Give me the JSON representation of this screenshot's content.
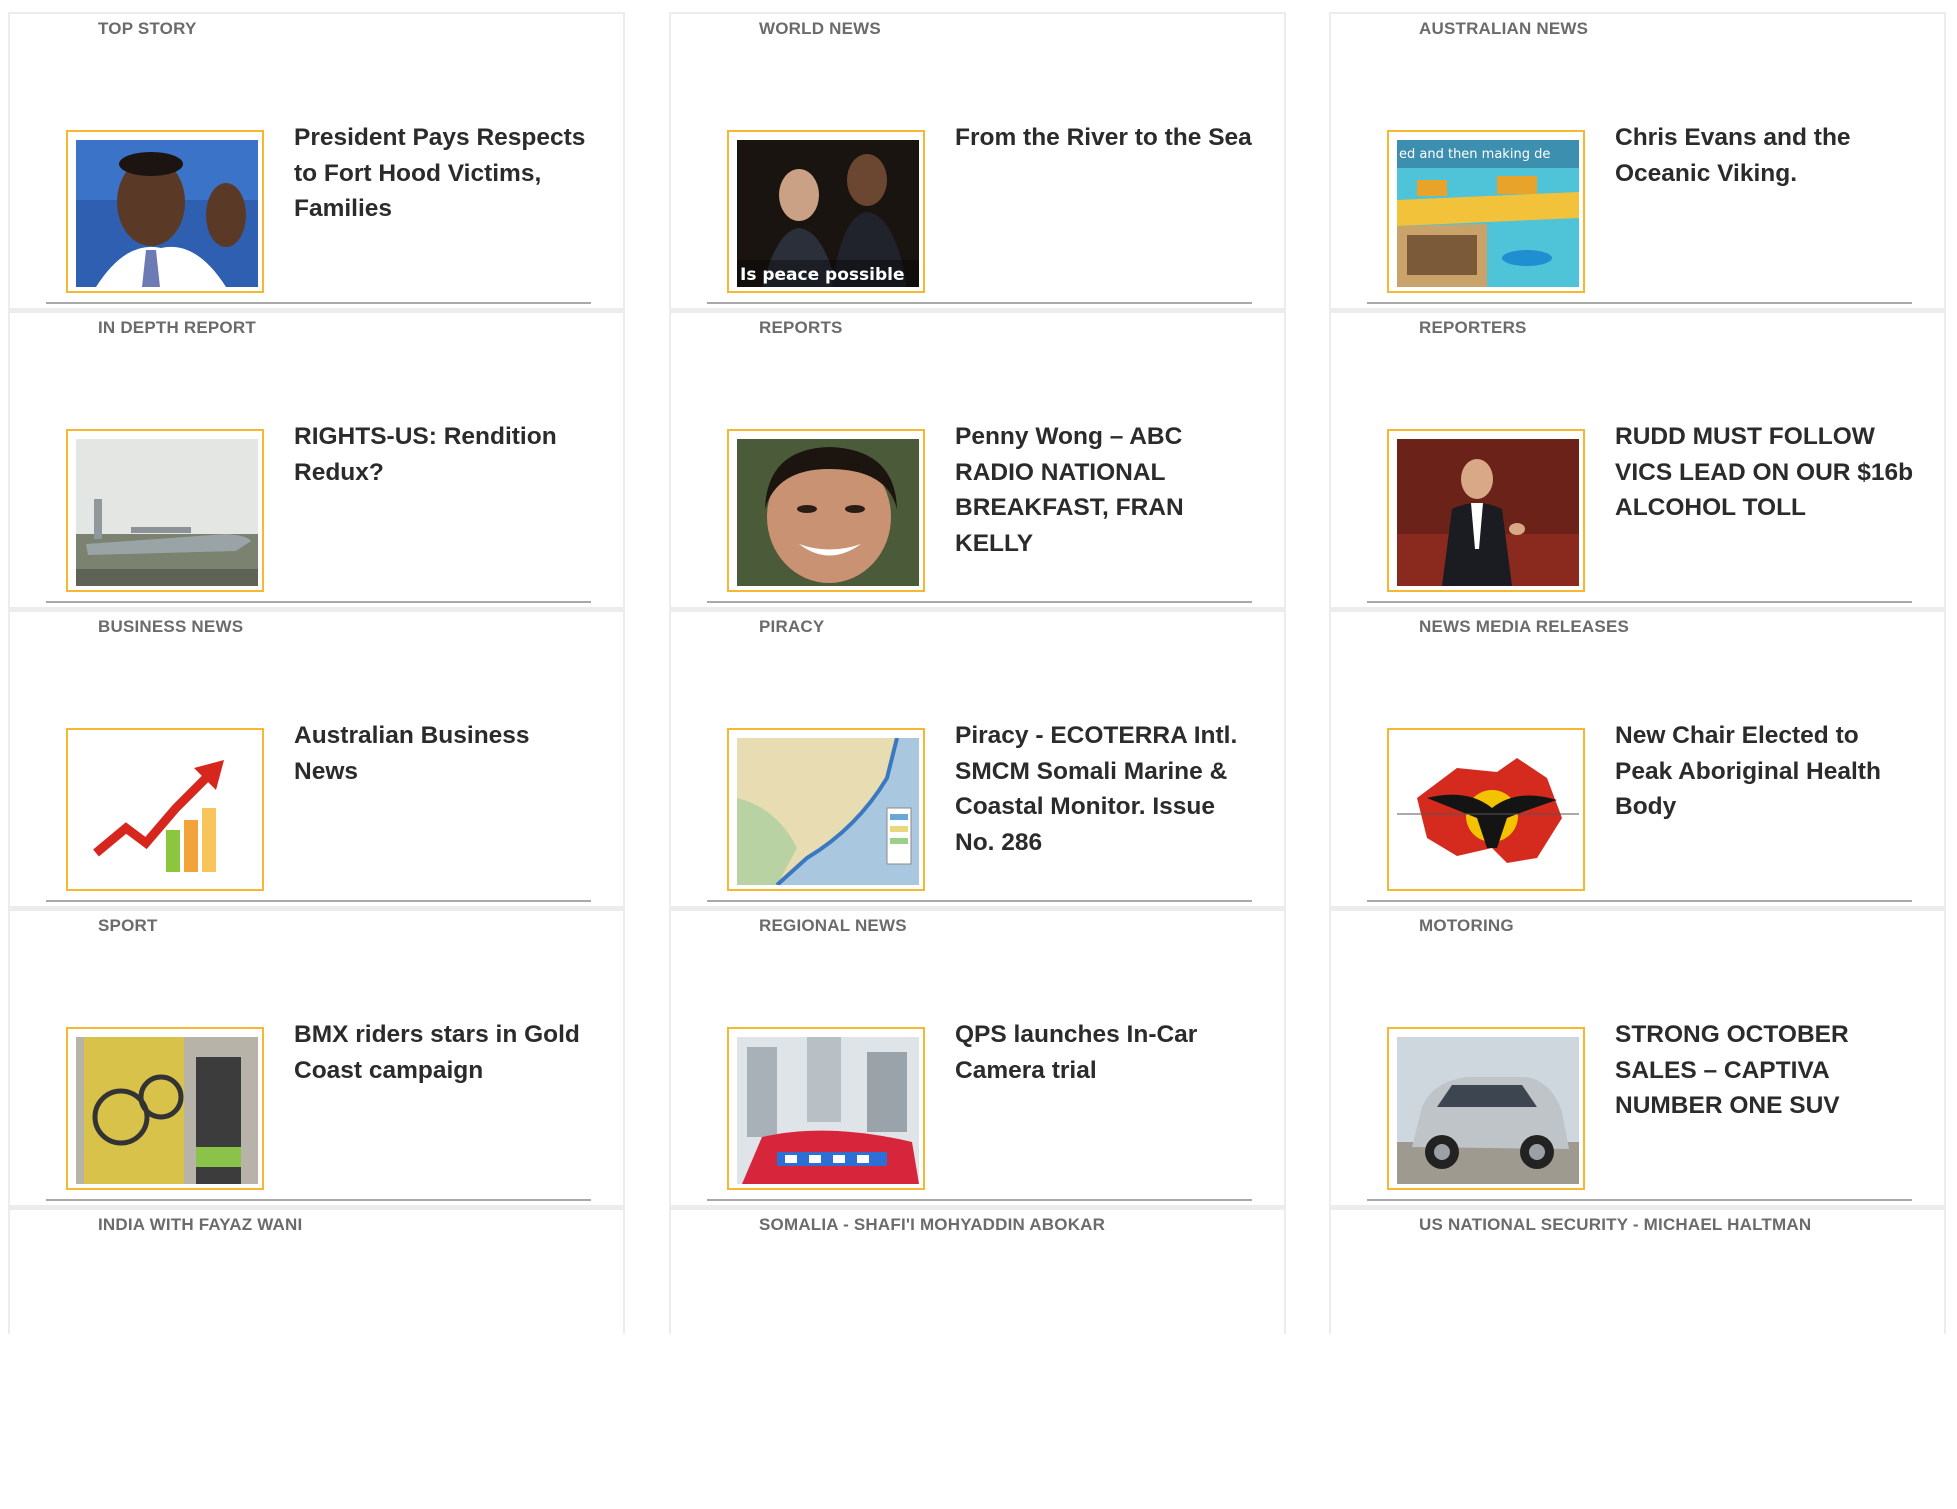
{
  "columns": [
    {
      "sections": [
        {
          "label": "TOP STORY",
          "headline": "President Pays Respects to Fort Hood Victims, Families",
          "image_icon": "portrait-photo"
        },
        {
          "label": "IN DEPTH REPORT",
          "headline": "RIGHTS-US: Rendition Redux?",
          "image_icon": "airplane-photo"
        },
        {
          "label": "BUSINESS NEWS",
          "headline": "Australian Business News",
          "image_icon": "growth-chart-photo"
        },
        {
          "label": "SPORT",
          "headline": "BMX riders stars in Gold Coast campaign",
          "image_icon": "bmx-poster-photo"
        },
        {
          "label": "INDIA WITH FAYAZ WANI"
        }
      ]
    },
    {
      "sections": [
        {
          "label": "WORLD NEWS",
          "headline": "From the River to the Sea",
          "image_icon": "two-leaders-photo",
          "image_caption": "Is peace possible"
        },
        {
          "label": "REPORTS",
          "headline": "Penny Wong – ABC RADIO NATIONAL BREAKFAST, FRAN KELLY",
          "image_icon": "portrait-photo"
        },
        {
          "label": "PIRACY",
          "headline": "Piracy - ECOTERRA Intl. SMCM Somali Marine & Coastal Monitor. Issue No. 286",
          "image_icon": "map-photo"
        },
        {
          "label": "REGIONAL NEWS",
          "headline": "QPS launches In-Car Camera trial",
          "image_icon": "police-car-photo"
        },
        {
          "label": "SOMALIA - SHAFI'I MOHYADDIN ABOKAR"
        }
      ]
    },
    {
      "sections": [
        {
          "label": "AUSTRALIAN NEWS",
          "headline": "Chris Evans and the Oceanic Viking.",
          "image_icon": "ship-photo",
          "image_caption": "ed and then making de"
        },
        {
          "label": "REPORTERS",
          "headline": "RUDD MUST FOLLOW VICS LEAD ON OUR $16b ALCOHOL TOLL",
          "image_icon": "parliament-photo"
        },
        {
          "label": "NEWS MEDIA RELEASES",
          "headline": "New Chair Elected to Peak Aboriginal Health Body",
          "image_icon": "aboriginal-health-logo"
        },
        {
          "label": "MOTORING",
          "headline": "STRONG OCTOBER SALES – CAPTIVA NUMBER ONE SUV",
          "image_icon": "suv-photo"
        },
        {
          "label": "US NATIONAL SECURITY - MICHAEL HALTMAN"
        }
      ]
    }
  ]
}
